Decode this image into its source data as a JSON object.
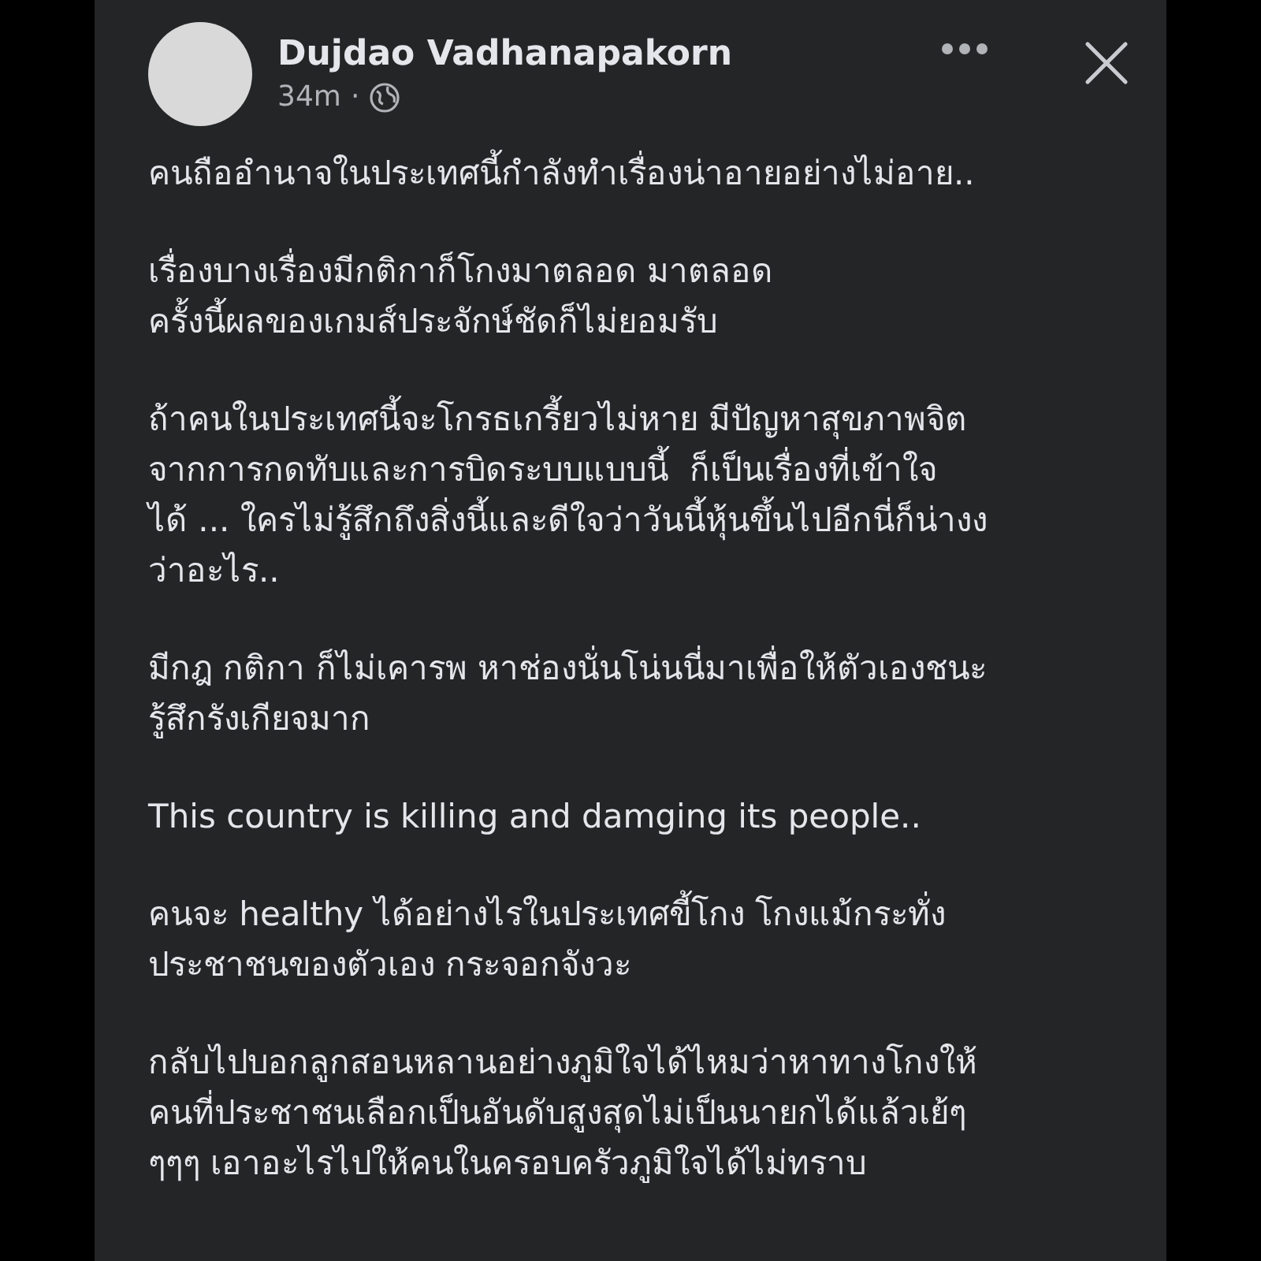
{
  "post": {
    "author": "Dujdao Vadhanapakorn",
    "time": "34m",
    "separator": "·",
    "paragraphs": [
      [
        "คนถืออำนาจในประเทศนี้กำลังทำเรื่องน่าอายอย่างไม่อาย.."
      ],
      [
        "เรื่องบางเรื่องมีกติกาก็โกงมาตลอด มาตลอด",
        "ครั้งนี้ผลของเกมส์ประจักษ์ชัดก็ไม่ยอมรับ"
      ],
      [
        "ถ้าคนในประเทศนี้จะโกรธเกรี้ยวไม่หาย มีปัญหาสุขภาพจิต",
        "จากการกดทับและการบิดระบบแบบนี้  ก็เป็นเรื่องที่เข้าใจ",
        "ได้ ... ใครไม่รู้สึกถึงสิ่งนี้และดีใจว่าวันนี้หุ้นขึ้นไปอีกนี่ก็น่างง",
        "ว่าอะไร.."
      ],
      [
        "มีกฎ กติกา ก็ไม่เคารพ หาช่องนั่นโน่นนี่มาเพื่อให้ตัวเองชนะ",
        "รู้สึกรังเกียจมาก"
      ],
      [
        "This country is killing and damging its people.."
      ],
      [
        "คนจะ healthy ได้อย่างไรในประเทศขี้โกง โกงแม้กระทั่ง",
        "ประชาชนของตัวเอง กระจอกจังวะ"
      ],
      [
        "กลับไปบอกลูกสอนหลานอย่างภูมิใจได้ไหมว่าหาทางโกงให้",
        "คนที่ประชาชนเลือกเป็นอันดับสูงสุดไม่เป็นนายกได้แล้วเย้ๆ",
        "ๆๆๆ เอาอะไรไปให้คนในครอบครัวภูมิใจได้ไม่ทราบ"
      ]
    ]
  }
}
